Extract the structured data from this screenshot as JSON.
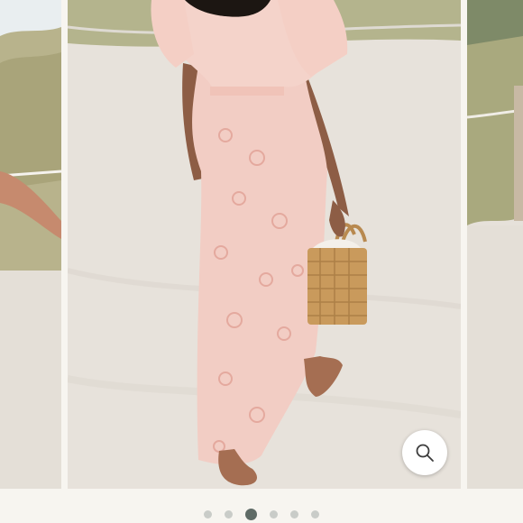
{
  "carousel": {
    "image_count": 6,
    "active_index": 2,
    "slides": [
      {
        "role": "previous",
        "subject": "beach-dunes-partial-arm"
      },
      {
        "role": "current",
        "subject": "woman-pink-floral-maxi-dress-wicker-basket-beach"
      },
      {
        "role": "next",
        "subject": "beach-dunes-rope-fence"
      }
    ]
  },
  "zoom": {
    "icon": "magnifier-icon"
  },
  "colors": {
    "page_bg": "#f7f5f0",
    "sand": "#e8e3dc",
    "dress_pink": "#f2c9c0",
    "dot_inactive": "#c9ccc8",
    "dot_active": "#5f6b66"
  }
}
